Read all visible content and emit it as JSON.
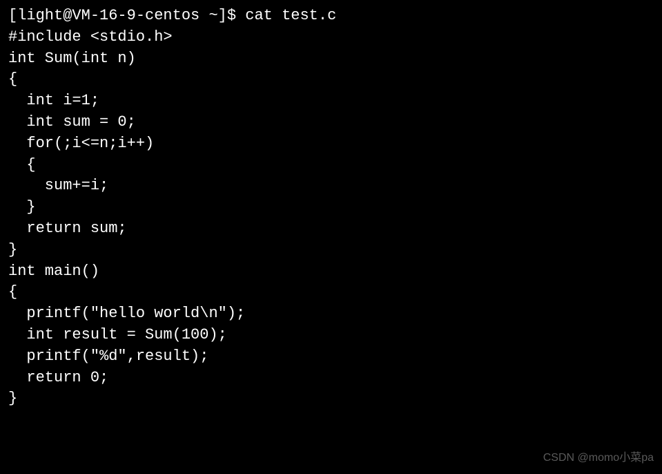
{
  "terminal": {
    "prompt": "[light@VM-16-9-centos ~]$ ",
    "command": "cat test.c",
    "lines": [
      "#include <stdio.h>",
      "",
      "int Sum(int n)",
      "{",
      "  int i=1;",
      "  int sum = 0;",
      "  for(;i<=n;i++)",
      "  {",
      "    sum+=i;",
      "  }",
      "  return sum;",
      "}",
      "int main()",
      "{",
      "  printf(\"hello world\\n\");",
      "  int result = Sum(100);",
      "  printf(\"%d\",result);",
      "  return 0;",
      "}"
    ]
  },
  "watermark": "CSDN @momo小菜pa"
}
